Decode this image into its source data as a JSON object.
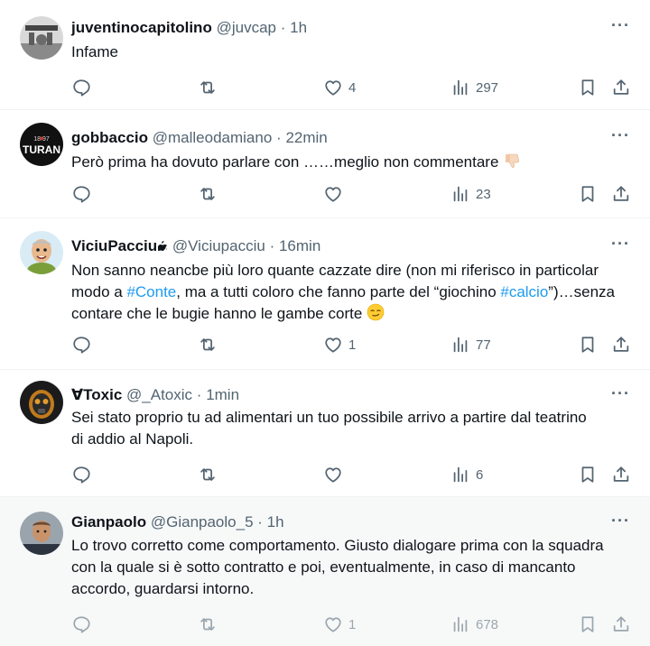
{
  "tweets": [
    {
      "name": "juventinocapitolino",
      "handle": "@juvcap",
      "sep": "·",
      "time": "1h",
      "text": "Infame",
      "likes": "4",
      "views": "297"
    },
    {
      "name": "gobbaccio",
      "handle": "@malleodamiano",
      "sep": "·",
      "time": "22min",
      "text": "Però prima ha dovuto parlare con ……meglio non commentare",
      "likes": "",
      "views": "23"
    },
    {
      "name": "ViciuPacciu",
      "handle": "@Viciupacciu",
      "sep": "·",
      "time": "16min",
      "text_a": "Non sanno neancbe più loro quante cazzate dire (non mi riferisco in particolar modo a ",
      "tag1": "#Conte",
      "text_b": ", ma a tutti coloro che fanno parte del “giochino ",
      "tag2": "#calcio",
      "text_c": "”)…senza contare che le bugie hanno le gambe corte",
      "likes": "1",
      "views": "77"
    },
    {
      "name": "∀Toxic",
      "handle": "@_Atoxic",
      "sep": "·",
      "time": "1min",
      "text": "Sei stato proprio tu ad alimentari un tuo possibile arrivo a partire dal teatrino di addio al Napoli.",
      "likes": "",
      "views": "6"
    },
    {
      "name": "Gianpaolo",
      "handle": "@Gianpaolo_5",
      "sep": "·",
      "time": "1h",
      "text": "Lo trovo corretto come comportamento. Giusto dialogare prima con la squadra con la quale si è sotto contratto e poi, eventualmente, in caso di mancanto accordo, guardarsi intorno.",
      "likes": "1",
      "views": "678"
    }
  ],
  "avatar_texts": {
    "turan_year": "18  97",
    "turan_word": "TURAN"
  },
  "colors": {
    "text": "#0f1419",
    "secondary": "#536471",
    "hashtag": "#1d9bf0",
    "divider": "#eff3f4",
    "highlight_bg": "#f7f9f9"
  },
  "icons": [
    "reply-icon",
    "retweet-icon",
    "like-icon",
    "views-icon",
    "bookmark-icon",
    "share-icon",
    "more-icon",
    "thumbs-down-emoji",
    "smirk-emoji",
    "apple-logo-icon"
  ]
}
